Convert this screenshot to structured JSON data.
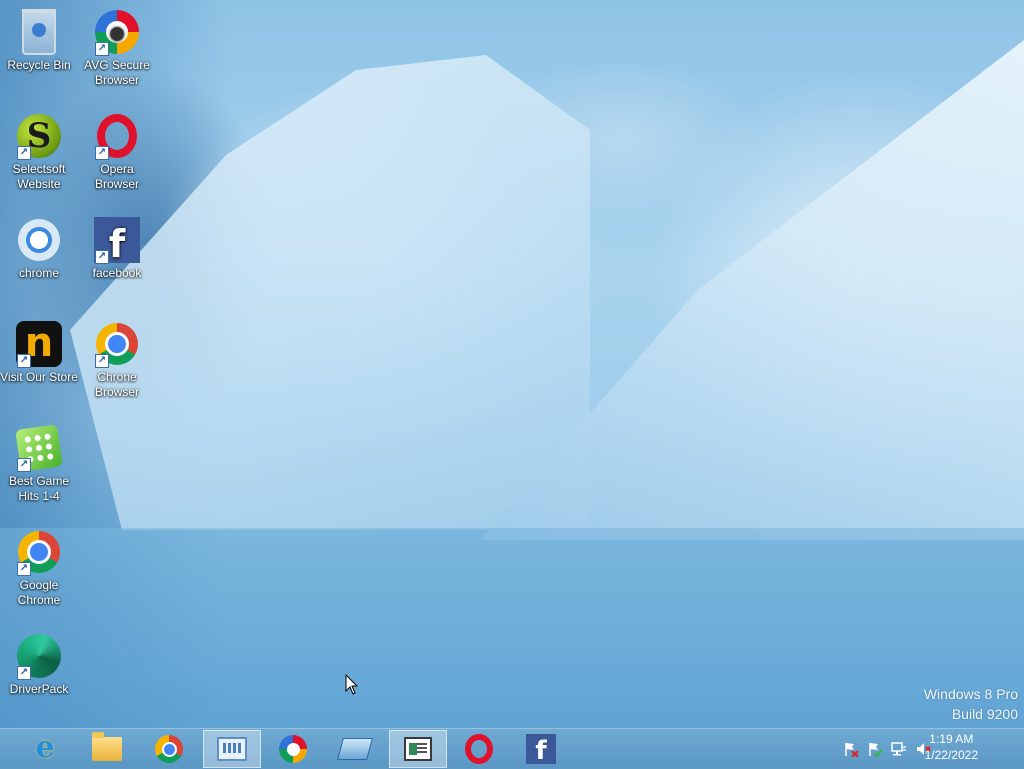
{
  "desktop": {
    "icons": [
      {
        "label": "Recycle Bin"
      },
      {
        "label": "AVG Secure Browser"
      },
      {
        "label": "Selectsoft Website"
      },
      {
        "label": "Opera Browser"
      },
      {
        "label": "chrome"
      },
      {
        "label": "facebook"
      },
      {
        "label": "Visit Our Store"
      },
      {
        "label": "Chrone Browser"
      },
      {
        "label": "Best Game Hits 1-4"
      },
      {
        "label": "Google Chrome"
      },
      {
        "label": "DriverPack"
      }
    ]
  },
  "watermark": {
    "edition": "Windows 8 Pro",
    "build": "Build 9200"
  },
  "taskbar": {
    "pinned": [
      {
        "name": "internet-explorer",
        "icon": "ie-icon"
      },
      {
        "name": "file-explorer",
        "icon": "folder-icon"
      },
      {
        "name": "google-chrome",
        "icon": "chrome-icon"
      },
      {
        "name": "system-properties",
        "icon": "system-properties-icon",
        "active": true
      },
      {
        "name": "avg-secure-browser",
        "icon": "avg-icon"
      },
      {
        "name": "remote-desktop",
        "icon": "remote-desktop-icon"
      },
      {
        "name": "news-app",
        "icon": "news-icon",
        "active": true
      },
      {
        "name": "opera",
        "icon": "opera-icon"
      },
      {
        "name": "facebook",
        "icon": "facebook-icon"
      }
    ],
    "tray": {
      "icons": [
        "action-center-flag-icon",
        "security-check-icon",
        "network-icon",
        "volume-muted-icon"
      ],
      "time": "1:19 AM",
      "date": "1/22/2022"
    }
  }
}
